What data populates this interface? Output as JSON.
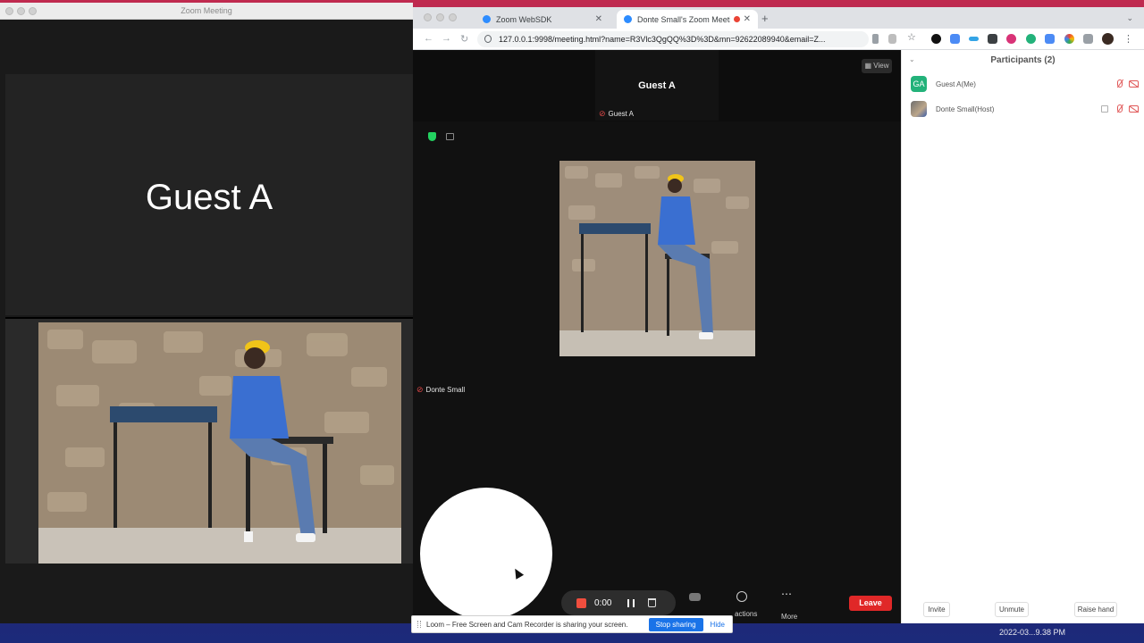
{
  "zoom_app": {
    "window_title": "Zoom Meeting",
    "speaker_name": "Guest A"
  },
  "browser": {
    "tabs": [
      {
        "label": "Zoom WebSDK",
        "active": false
      },
      {
        "label": "Donte Small's Zoom Meeting",
        "active": true,
        "recording": true
      }
    ],
    "new_tab_label": "+",
    "url": "127.0.0.1:9998/meeting.html?name=R3Vlc3QgQQ%3D%3D&mn=92622089940&email=Z...",
    "extension_icons": [
      "extension-dark-circle",
      "extension-grid",
      "extension-share",
      "extension-hash",
      "extension-gear",
      "extension-green",
      "extension-chrome",
      "extension-color",
      "extension-puzzle",
      "profile-avatar"
    ]
  },
  "meeting": {
    "view_label": "View",
    "active_speaker": "Guest A",
    "active_speaker_tag": "Guest A",
    "gallery_tile_name": "Donte Small",
    "recorder": {
      "time": "0:00"
    },
    "controls": {
      "reactions_label": "actions",
      "more_label": "More",
      "leave_label": "Leave"
    }
  },
  "participants": {
    "title": "Participants (2)",
    "list": [
      {
        "initials": "GA",
        "name": "Guest A(Me)"
      },
      {
        "initials": "",
        "name": "Donte Small(Host)"
      }
    ],
    "buttons": {
      "invite": "Invite",
      "unmute": "Unmute",
      "raise_hand": "Raise hand"
    }
  },
  "share_banner": {
    "text": "Loom – Free Screen and Cam Recorder is sharing your screen.",
    "stop_label": "Stop sharing",
    "hide_label": "Hide"
  },
  "system": {
    "clock": "2022-03...9.38 PM"
  },
  "colors": {
    "leave_red": "#e02828",
    "record_red": "#f04e3e",
    "stop_share_blue": "#1a73e8",
    "avatar_green": "#23b27a"
  }
}
